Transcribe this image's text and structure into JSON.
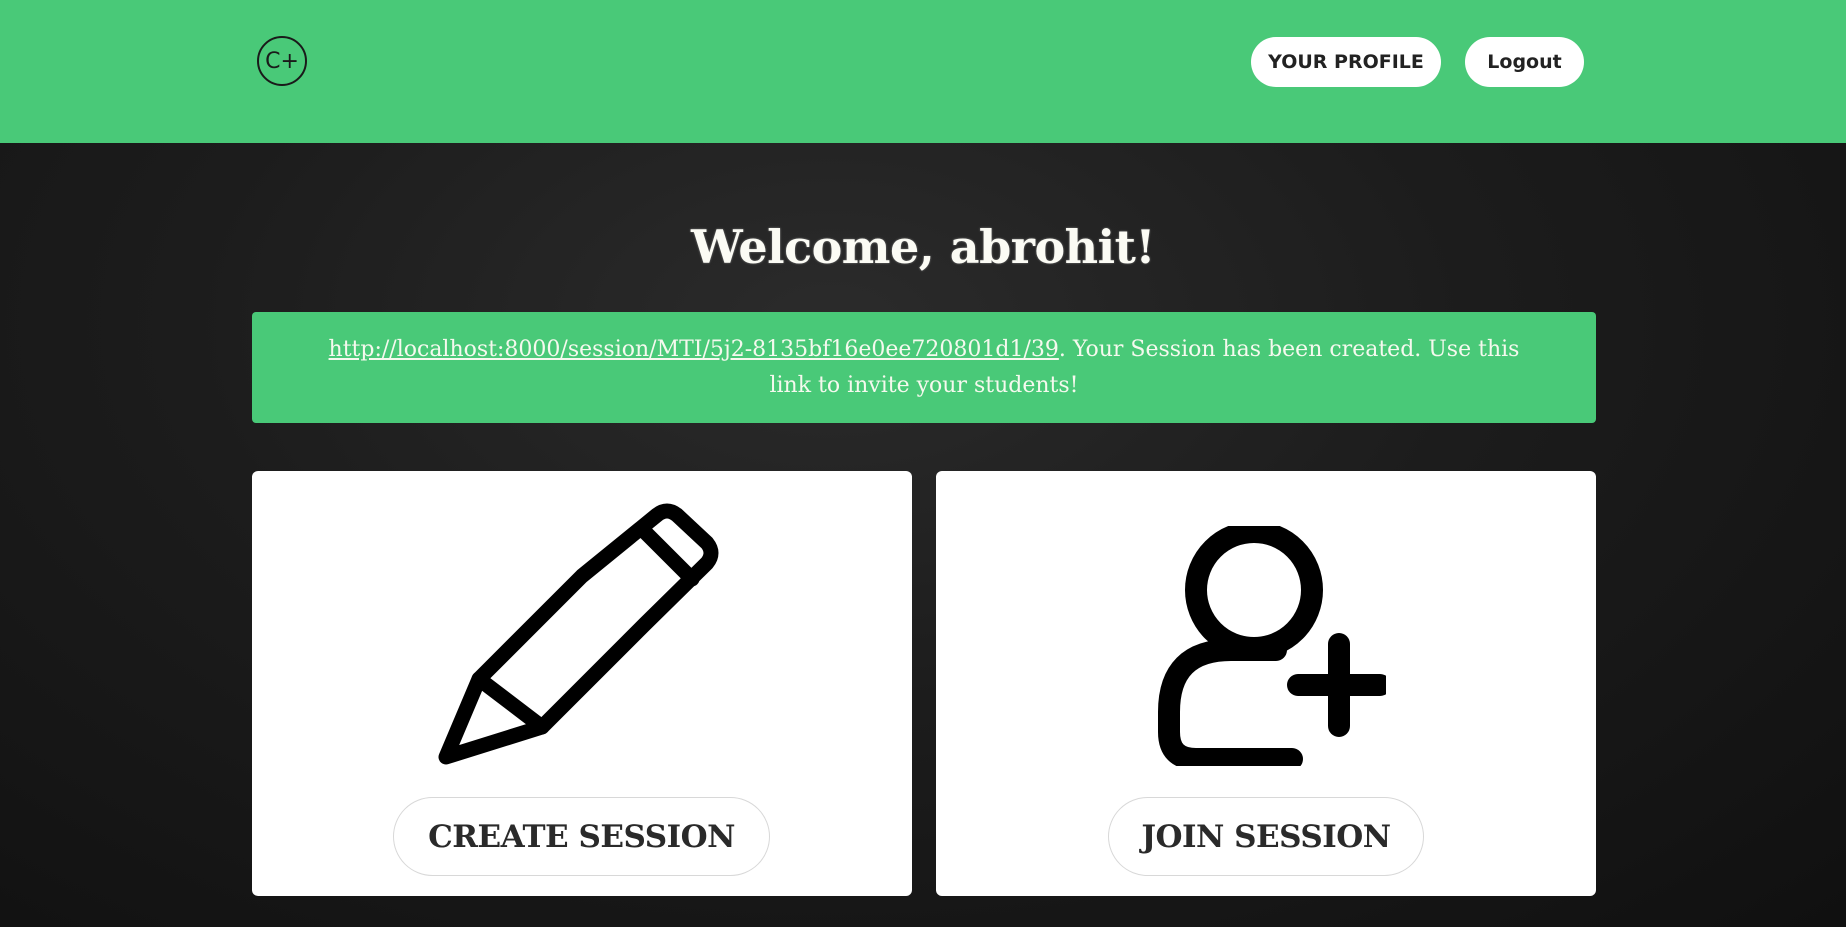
{
  "header": {
    "logo_text": "C+",
    "profile_label": "YOUR PROFILE",
    "logout_label": "Logout"
  },
  "main": {
    "welcome": "Welcome, abrohit!",
    "alert": {
      "link": "http://localhost:8000/session/MTI/5j2-8135bf16e0ee720801d1/39",
      "message": ". Your Session has been created. Use this link to invite your students!"
    },
    "cards": {
      "create": {
        "icon": "pencil-icon",
        "label": "CREATE SESSION"
      },
      "join": {
        "icon": "add-user-icon",
        "label": "JOIN SESSION"
      }
    }
  },
  "colors": {
    "brand_green": "#49c978",
    "background": "#1c1c1c",
    "card": "#ffffff"
  }
}
